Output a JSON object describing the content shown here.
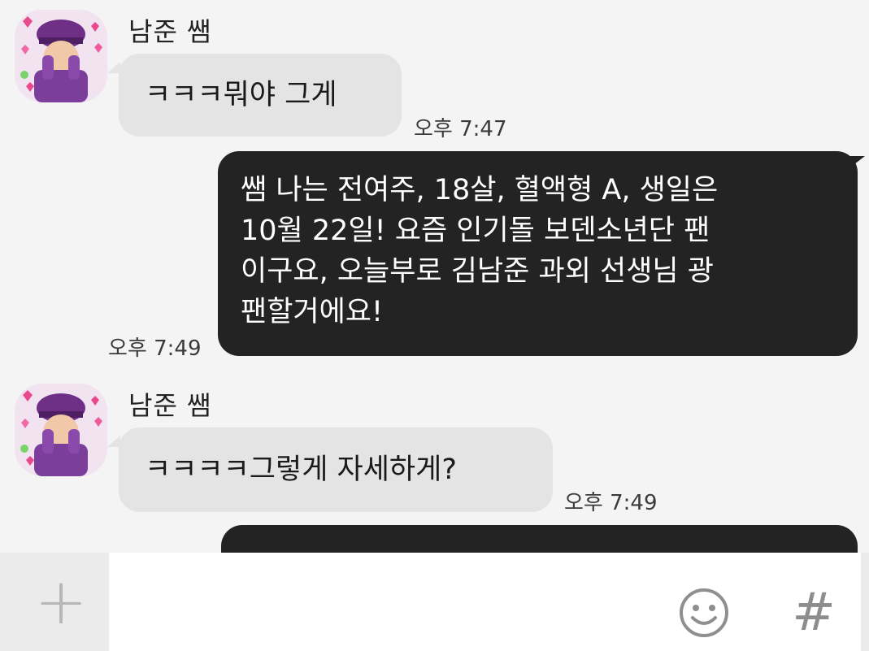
{
  "messages": [
    {
      "sender": "남준 쌤",
      "direction": "incoming",
      "text": "ㅋㅋㅋ뭐야 그게",
      "time": "오후 7:47"
    },
    {
      "direction": "outgoing",
      "lines": [
        "쌤 나는 전여주, 18살, 혈액형 A, 생일은",
        "10월 22일! 요즘 인기돌 보덴소년단 팬",
        "이구요, 오늘부로 김남준 과외 선생님 광",
        "팬할거에요!"
      ],
      "time": "오후 7:49"
    },
    {
      "sender": "남준 쌤",
      "direction": "incoming",
      "text": "ㅋㅋㅋㅋ그렇게 자세하게?",
      "time": "오후 7:49"
    }
  ],
  "input_bar": {
    "plus_label": "+",
    "hash_label": "#",
    "emoji_icon": "smiley-icon"
  },
  "colors": {
    "background": "#f4f4f4",
    "incoming_bubble": "#e4e4e4",
    "outgoing_bubble": "#232323",
    "outgoing_text": "#ffffff"
  }
}
